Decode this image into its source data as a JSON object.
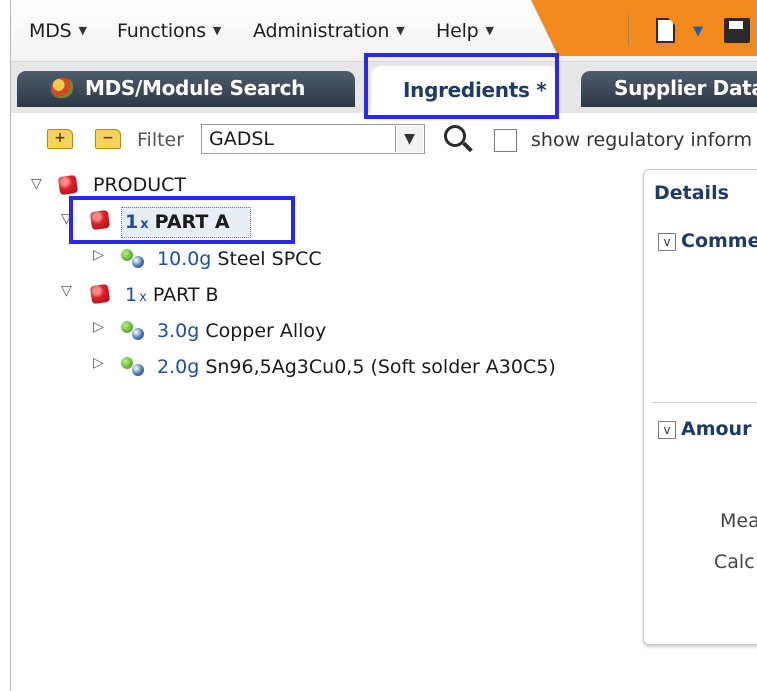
{
  "menubar": {
    "items": [
      {
        "label": "MDS"
      },
      {
        "label": "Functions"
      },
      {
        "label": "Administration"
      },
      {
        "label": "Help"
      }
    ]
  },
  "tabs": [
    {
      "label": "MDS/Module Search"
    },
    {
      "label": "Ingredients *"
    },
    {
      "label": "Supplier Data"
    }
  ],
  "toolbar": {
    "filter_label": "Filter",
    "filter_value": "GADSL",
    "checkbox_label": "show regulatory inform"
  },
  "tree": {
    "root": {
      "label": "PRODUCT"
    },
    "parts": [
      {
        "multiplier": "1",
        "multiplier_suffix": "x",
        "label": "PART A",
        "materials": [
          {
            "qty": "10.0g",
            "label": "Steel SPCC"
          }
        ]
      },
      {
        "multiplier": "1",
        "multiplier_suffix": "x",
        "label": "PART B",
        "materials": [
          {
            "qty": "3.0g",
            "label": "Copper Alloy"
          },
          {
            "qty": "2.0g",
            "label": "Sn96,5Ag3Cu0,5 (Soft solder A30C5)"
          }
        ]
      }
    ]
  },
  "details": {
    "title": "Details",
    "section_comment": "Comme",
    "section_amount": "Amour",
    "field_measured": "Mea",
    "field_calculated": "Calc"
  },
  "colors": {
    "accent_orange": "#f28a1e",
    "tab_dark": "#2d3946",
    "tab_active_text": "#1e3b66",
    "highlight": "#2828f0",
    "qty_blue": "#1c4f9c"
  }
}
